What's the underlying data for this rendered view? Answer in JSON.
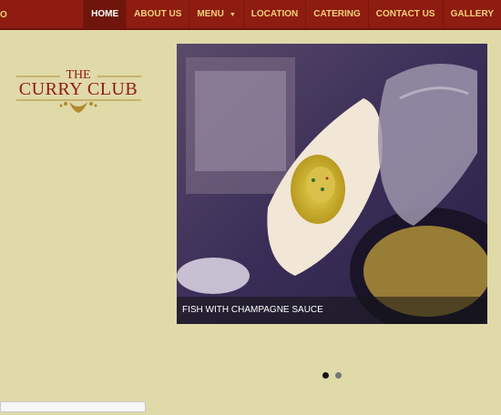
{
  "topbar": {
    "left_glyph": "O"
  },
  "nav": {
    "items": [
      {
        "label": "HOME"
      },
      {
        "label": "ABOUT US"
      },
      {
        "label": "MENU"
      },
      {
        "label": "LOCATION"
      },
      {
        "label": "CATERING"
      },
      {
        "label": "CONTACT US"
      },
      {
        "label": "GALLERY"
      }
    ]
  },
  "logo": {
    "line1": "THE",
    "line2": "CURRY CLUB"
  },
  "slider": {
    "caption": "FISH WITH CHAMPAGNE SAUCE",
    "slide_count": 2,
    "active_index": 0
  },
  "colors": {
    "background": "#e0d9a8",
    "nav_bg": "#8e1c10",
    "nav_text": "#f1d27a",
    "logo_red": "#8e1c10",
    "logo_gold": "#b08a2e"
  },
  "icons": {
    "menu_caret": "chevron-down-icon",
    "logo_ornament": "crown-ornament-icon"
  }
}
